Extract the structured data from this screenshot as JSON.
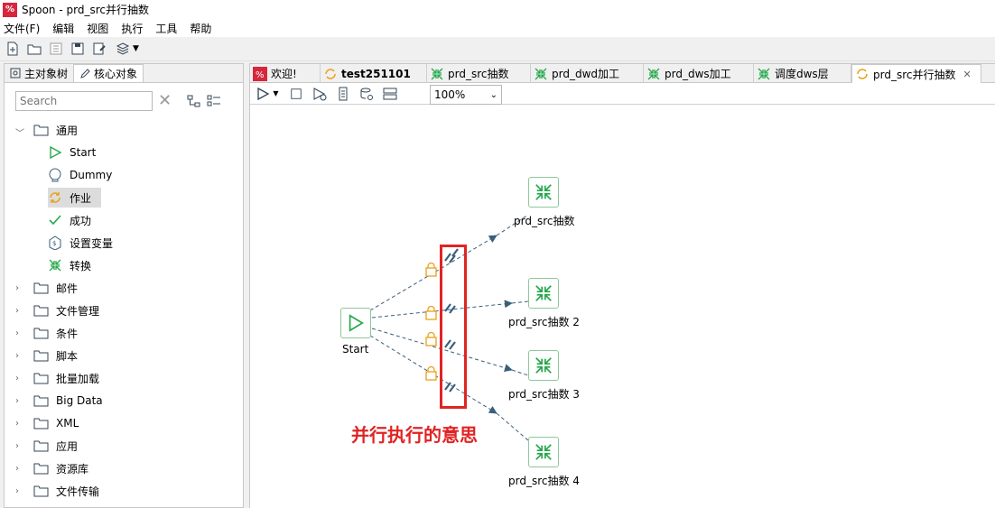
{
  "window": {
    "title": "Spoon - prd_src并行抽数",
    "icon": "spoon-app-icon"
  },
  "menu": [
    "文件(F)",
    "编辑",
    "视图",
    "执行",
    "工具",
    "帮助"
  ],
  "left_tabs": [
    {
      "label": "主对象树",
      "icon": "tree-icon"
    },
    {
      "label": "核心对象",
      "icon": "pencil-icon"
    }
  ],
  "search": {
    "placeholder": "Search"
  },
  "tree": {
    "general": "通用",
    "children": [
      "Start",
      "Dummy",
      "作业",
      "成功",
      "设置变量",
      "转换"
    ],
    "folders": [
      "邮件",
      "文件管理",
      "条件",
      "脚本",
      "批量加载",
      "Big Data",
      "XML",
      "应用",
      "资源库",
      "文件传输"
    ]
  },
  "tabs": [
    {
      "label": "欢迎!"
    },
    {
      "label": "test251101"
    },
    {
      "label": "prd_src抽数"
    },
    {
      "label": "prd_dwd加工"
    },
    {
      "label": "prd_dws加工"
    },
    {
      "label": "调度dws层"
    },
    {
      "label": "prd_src并行抽数"
    }
  ],
  "zoom": "100%",
  "canvas": {
    "start_label": "Start",
    "targets": [
      "prd_src抽数",
      "prd_src抽数 2",
      "prd_src抽数 3",
      "prd_src抽数 4"
    ],
    "annotation": "并行执行的意思"
  },
  "colors": {
    "accent_red": "#e02424",
    "node_green": "#23a84a",
    "hop_blue": "#3a5f7a",
    "lock_orange": "#e8a11a"
  }
}
